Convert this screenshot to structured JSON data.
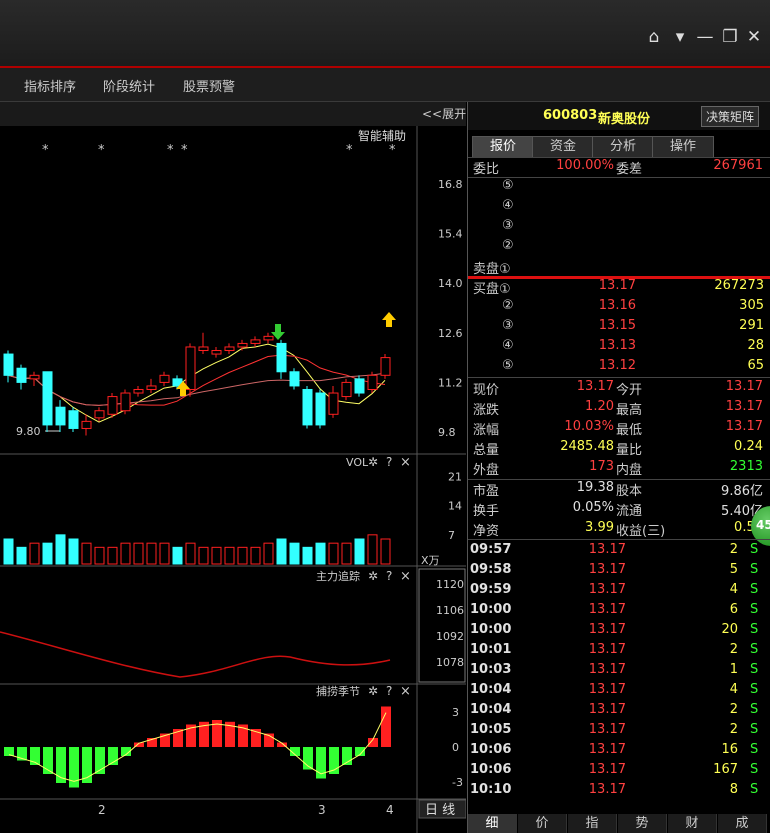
{
  "window": {
    "controls": [
      "home-icon",
      "dropdown-icon",
      "minimize-icon",
      "restore-icon",
      "close-icon"
    ]
  },
  "menu": {
    "items": [
      "指标排序",
      "阶段统计",
      "股票预警"
    ]
  },
  "chart": {
    "expand_label": "<<展开",
    "smart_assist": "智能辅助",
    "stars": [
      "*",
      "*",
      "*",
      "*",
      "*",
      "*"
    ],
    "price_axis": [
      "16.8",
      "15.4",
      "14.0",
      "12.6",
      "11.2",
      "9.8"
    ],
    "low_label": "9.80",
    "vol_title": "VOL",
    "vol_axis": [
      "21",
      "14",
      "7"
    ],
    "vol_unit": "X万",
    "main_title": "主力追踪",
    "main_axis": [
      "1120",
      "1106",
      "1092",
      "1078"
    ],
    "catch_title": "捕捞季节",
    "catch_axis": [
      "3",
      "0",
      "-3"
    ],
    "x_labels": [
      "2",
      "3",
      "4"
    ],
    "period_label": "日 线",
    "help_icon": "?",
    "close_icon": "×"
  },
  "chart_data": {
    "type": "candlestick",
    "price_ylim": [
      9.8,
      16.8
    ],
    "candles": [
      {
        "o": 12.0,
        "c": 11.4,
        "h": 12.1,
        "l": 11.2,
        "up": false
      },
      {
        "o": 11.6,
        "c": 11.2,
        "h": 11.7,
        "l": 11.0,
        "up": false
      },
      {
        "o": 11.3,
        "c": 11.4,
        "h": 11.5,
        "l": 11.1,
        "up": true
      },
      {
        "o": 11.5,
        "c": 10.0,
        "h": 11.5,
        "l": 9.8,
        "up": false
      },
      {
        "o": 10.5,
        "c": 10.0,
        "h": 10.7,
        "l": 9.8,
        "up": false
      },
      {
        "o": 10.4,
        "c": 9.9,
        "h": 10.5,
        "l": 9.8,
        "up": false
      },
      {
        "o": 9.9,
        "c": 10.1,
        "h": 10.3,
        "l": 9.7,
        "up": true
      },
      {
        "o": 10.2,
        "c": 10.4,
        "h": 10.5,
        "l": 10.1,
        "up": true
      },
      {
        "o": 10.3,
        "c": 10.8,
        "h": 10.9,
        "l": 10.2,
        "up": true
      },
      {
        "o": 10.4,
        "c": 10.9,
        "h": 11.0,
        "l": 10.3,
        "up": true
      },
      {
        "o": 10.9,
        "c": 11.0,
        "h": 11.1,
        "l": 10.8,
        "up": true
      },
      {
        "o": 11.0,
        "c": 11.1,
        "h": 11.3,
        "l": 10.9,
        "up": true
      },
      {
        "o": 11.2,
        "c": 11.4,
        "h": 11.5,
        "l": 11.1,
        "up": true
      },
      {
        "o": 11.3,
        "c": 11.1,
        "h": 11.4,
        "l": 11.0,
        "up": false
      },
      {
        "o": 11.0,
        "c": 12.2,
        "h": 12.3,
        "l": 10.8,
        "up": true
      },
      {
        "o": 12.2,
        "c": 12.1,
        "h": 12.6,
        "l": 12.0,
        "up": true
      },
      {
        "o": 12.1,
        "c": 12.0,
        "h": 12.2,
        "l": 11.9,
        "up": true
      },
      {
        "o": 12.1,
        "c": 12.2,
        "h": 12.3,
        "l": 12.0,
        "up": true
      },
      {
        "o": 12.2,
        "c": 12.3,
        "h": 12.4,
        "l": 12.1,
        "up": true
      },
      {
        "o": 12.3,
        "c": 12.4,
        "h": 12.5,
        "l": 12.2,
        "up": true
      },
      {
        "o": 12.4,
        "c": 12.5,
        "h": 12.6,
        "l": 12.3,
        "up": true
      },
      {
        "o": 12.3,
        "c": 11.5,
        "h": 12.4,
        "l": 11.3,
        "up": false
      },
      {
        "o": 11.5,
        "c": 11.1,
        "h": 11.6,
        "l": 11.0,
        "up": false
      },
      {
        "o": 11.0,
        "c": 10.0,
        "h": 11.1,
        "l": 9.9,
        "up": false
      },
      {
        "o": 10.9,
        "c": 10.0,
        "h": 11.0,
        "l": 9.9,
        "up": false
      },
      {
        "o": 10.3,
        "c": 10.9,
        "h": 11.1,
        "l": 10.2,
        "up": true
      },
      {
        "o": 10.8,
        "c": 11.2,
        "h": 11.3,
        "l": 10.7,
        "up": true
      },
      {
        "o": 11.3,
        "c": 10.9,
        "h": 11.4,
        "l": 10.8,
        "up": false
      },
      {
        "o": 11.0,
        "c": 11.4,
        "h": 11.5,
        "l": 10.9,
        "up": true
      },
      {
        "o": 11.4,
        "c": 11.9,
        "h": 12.0,
        "l": 11.3,
        "up": true
      }
    ],
    "vol_ylim": [
      0,
      24
    ],
    "volumes": [
      6,
      4,
      5,
      5,
      7,
      6,
      5,
      4,
      4,
      5,
      5,
      5,
      5,
      4,
      5,
      4,
      4,
      4,
      4,
      4,
      5,
      6,
      5,
      4,
      5,
      5,
      5,
      6,
      7,
      6
    ],
    "macd": [
      -1,
      -1.5,
      -2,
      -3,
      -4,
      -4.5,
      -4,
      -3,
      -2,
      -1,
      0.5,
      1,
      1.5,
      2,
      2.5,
      2.8,
      3,
      2.8,
      2.5,
      2,
      1.5,
      0.5,
      -1,
      -2.5,
      -3.5,
      -3,
      -2,
      -1,
      1,
      4.5
    ],
    "macd_ylim": [
      -5,
      5
    ]
  },
  "stock": {
    "code": "600803",
    "name": "新奥股份",
    "matrix_button": "决策矩阵",
    "tabs": [
      "报价",
      "资金",
      "分析",
      "操作"
    ],
    "weibi_label": "委比",
    "weibi_value": "100.00%",
    "weicha_label": "委差",
    "weicha_value": "267961",
    "sell_levels": [
      "⑤",
      "④",
      "③",
      "②",
      "卖盘①"
    ],
    "buy_label": "买盘①",
    "buy_levels": [
      {
        "level": "买盘①",
        "price": "13.17",
        "volume": "267273"
      },
      {
        "level": "②",
        "price": "13.16",
        "volume": "305"
      },
      {
        "level": "③",
        "price": "13.15",
        "volume": "291"
      },
      {
        "level": "④",
        "price": "13.13",
        "volume": "28"
      },
      {
        "level": "⑤",
        "price": "13.12",
        "volume": "65"
      }
    ],
    "quotes": [
      {
        "l1": "现价",
        "v1": "13.17",
        "c1": "red",
        "l2": "今开",
        "v2": "13.17",
        "c2": "red"
      },
      {
        "l1": "涨跌",
        "v1": "1.20",
        "c1": "red",
        "l2": "最高",
        "v2": "13.17",
        "c2": "red"
      },
      {
        "l1": "涨幅",
        "v1": "10.03%",
        "c1": "red",
        "l2": "最低",
        "v2": "13.17",
        "c2": "red"
      },
      {
        "l1": "总量",
        "v1": "2485.48",
        "c1": "yel",
        "l2": "量比",
        "v2": "0.24",
        "c2": "yel"
      },
      {
        "l1": "外盘",
        "v1": "173",
        "c1": "red",
        "l2": "内盘",
        "v2": "2313",
        "c2": "grn"
      },
      {
        "l1": "市盈",
        "v1": "19.38",
        "c1": "wht",
        "l2": "股本",
        "v2": "9.86亿",
        "c2": "wht"
      },
      {
        "l1": "换手",
        "v1": "0.05%",
        "c1": "wht",
        "l2": "流通",
        "v2": "5.40亿",
        "c2": "wht"
      },
      {
        "l1": "净资",
        "v1": "3.99",
        "c1": "yel",
        "l2": "收益(三)",
        "v2": "0.51",
        "c2": "yel"
      }
    ],
    "badge": "45",
    "trades": [
      {
        "t": "09:57",
        "p": "13.17",
        "v": "2",
        "s": "S"
      },
      {
        "t": "09:58",
        "p": "13.17",
        "v": "5",
        "s": "S"
      },
      {
        "t": "09:59",
        "p": "13.17",
        "v": "4",
        "s": "S"
      },
      {
        "t": "10:00",
        "p": "13.17",
        "v": "6",
        "s": "S"
      },
      {
        "t": "10:00",
        "p": "13.17",
        "v": "20",
        "s": "S"
      },
      {
        "t": "10:01",
        "p": "13.17",
        "v": "2",
        "s": "S"
      },
      {
        "t": "10:03",
        "p": "13.17",
        "v": "1",
        "s": "S"
      },
      {
        "t": "10:04",
        "p": "13.17",
        "v": "4",
        "s": "S"
      },
      {
        "t": "10:04",
        "p": "13.17",
        "v": "2",
        "s": "S"
      },
      {
        "t": "10:05",
        "p": "13.17",
        "v": "2",
        "s": "S"
      },
      {
        "t": "10:06",
        "p": "13.17",
        "v": "16",
        "s": "S"
      },
      {
        "t": "10:06",
        "p": "13.17",
        "v": "167",
        "s": "S"
      },
      {
        "t": "10:10",
        "p": "13.17",
        "v": "8",
        "s": "S"
      }
    ],
    "bottom_tabs": [
      "细",
      "价",
      "指",
      "势",
      "财",
      "成"
    ]
  },
  "colors": {
    "up": "#ff2020",
    "down": "#33ffff",
    "accent_red": "#b00000",
    "grid": "#333333"
  }
}
